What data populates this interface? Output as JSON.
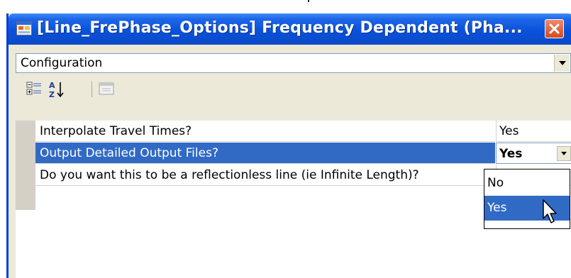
{
  "window": {
    "title": "[Line_FrePhase_Options] Frequency Dependent (Pha...",
    "icons": {
      "app": "form-icon",
      "close": "close-icon"
    },
    "colors": {
      "titlebar": "#0a52db",
      "selection": "#316ac5",
      "close": "#d44a22"
    }
  },
  "category_combo": {
    "value": "Configuration"
  },
  "toolbar": {
    "buttons": [
      "categorized-icon",
      "alphabetical-sort-icon",
      "property-pages-icon"
    ]
  },
  "properties": [
    {
      "name": "Interpolate Travel Times?",
      "value": "Yes"
    },
    {
      "name": "Output Detailed Output Files?",
      "value": "Yes",
      "selected": true
    },
    {
      "name": "Do you want this to be a reflectionless line (ie Infinite Length)?",
      "value": ""
    }
  ],
  "dropdown": {
    "options": [
      "No",
      "Yes"
    ],
    "highlighted": "Yes"
  }
}
